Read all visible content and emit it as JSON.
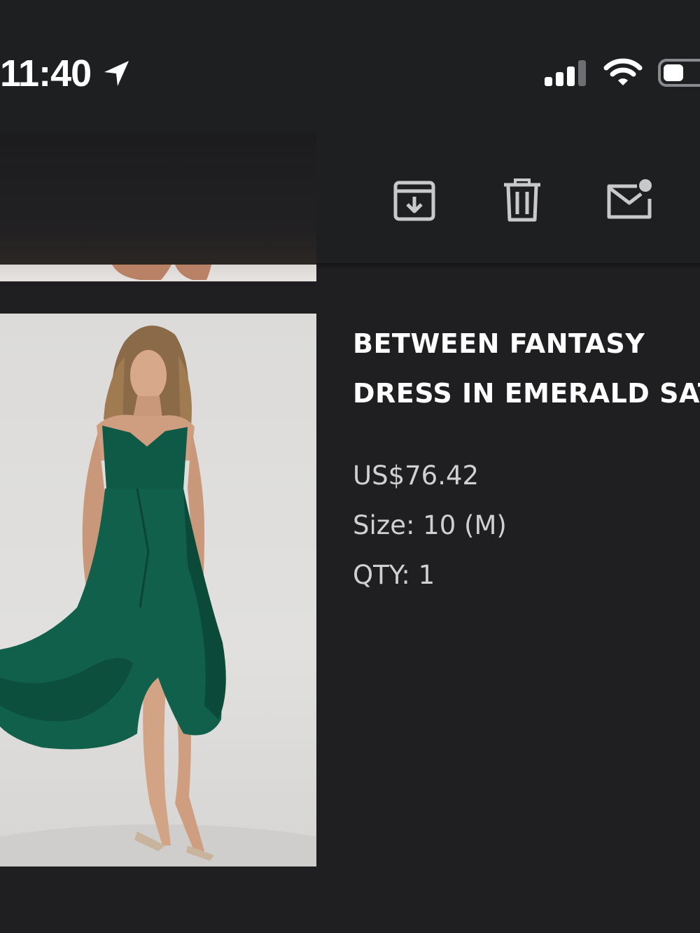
{
  "status_bar": {
    "time": "11:40",
    "icons": [
      "location-arrow-icon",
      "cellular-signal-icon",
      "wifi-icon",
      "battery-icon"
    ]
  },
  "toolbar": {
    "icons": [
      "archive-icon",
      "trash-icon",
      "mark-unread-icon"
    ]
  },
  "product": {
    "title_line1": "BETWEEN FANTASY",
    "title_line2": "DRESS IN EMERALD SATIN",
    "price": "US$76.42",
    "size": "Size:  10  (M)",
    "qty": "QTY:  1"
  },
  "colors": {
    "background": "#1f1f22",
    "text_primary": "#ffffff",
    "text_secondary": "#d0d0d2",
    "icon": "#c9c9cb",
    "dress": "#0f5a46"
  }
}
